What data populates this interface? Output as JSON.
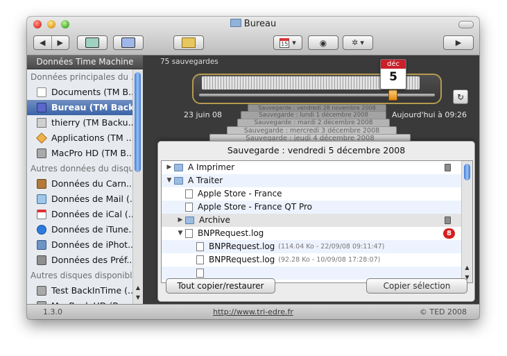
{
  "window": {
    "title": "Bureau"
  },
  "toolbar": {
    "back_icon": "arrow-left-icon",
    "forward_icon": "arrow-right-icon",
    "calendar_day": "15",
    "chevron": "▾",
    "play_icon": "▶"
  },
  "sidebar": {
    "header": "Données Time Machine",
    "groups": [
      {
        "label": "Données principales du ...",
        "items": [
          {
            "label": "Documents (TM B...",
            "icon": "document-icon"
          },
          {
            "label": "Bureau (TM Backu...",
            "icon": "desktop-icon",
            "selected": true
          },
          {
            "label": "thierry (TM Backu...",
            "icon": "home-icon"
          },
          {
            "label": "Applications (TM ...",
            "icon": "applications-icon"
          },
          {
            "label": "MacPro HD (TM B...",
            "icon": "hard-disk-icon"
          }
        ]
      },
      {
        "label": "Autres données du disque...",
        "items": [
          {
            "label": "Données du Carn...",
            "icon": "address-book-icon"
          },
          {
            "label": "Données de Mail (...",
            "icon": "mail-icon"
          },
          {
            "label": "Données de iCal (...",
            "icon": "ical-icon"
          },
          {
            "label": "Données de iTune...",
            "icon": "itunes-icon"
          },
          {
            "label": "Données de iPhot...",
            "icon": "iphoto-icon"
          },
          {
            "label": "Données des Préf...",
            "icon": "preferences-icon"
          }
        ]
      },
      {
        "label": "Autres disques disponibles",
        "items": [
          {
            "label": "Test BackInTime (...",
            "icon": "hard-disk-icon"
          },
          {
            "label": "MacBook HD (Ba...",
            "icon": "hard-disk-icon"
          }
        ]
      }
    ]
  },
  "timeline": {
    "count": "75 sauvegardes",
    "start": "23 juin 08",
    "end": "Aujourd'hui à 09:26",
    "calendar_month": "déc",
    "calendar_day": "5",
    "refresh_icon": "↻",
    "stack": [
      "Sauvegarde : vendredi 28 novembre 2008",
      "Sauvegarde : lundi 1 décembre 2008",
      "Sauvegarde : mardi 2 décembre 2008",
      "Sauvegarde : mercredi 3 décembre 2008",
      "Sauvegarde : jeudi 4 décembre 2008"
    ]
  },
  "backup": {
    "title": "Sauvegarde : vendredi 5 décembre 2008",
    "rows": [
      {
        "name": "A Imprimer",
        "type": "folder",
        "expander": "▶",
        "level": 0,
        "trash": true
      },
      {
        "name": "A Traiter",
        "type": "folder",
        "expander": "▼",
        "level": 0
      },
      {
        "name": "Apple Store - France",
        "type": "file",
        "expander": "",
        "level": 1
      },
      {
        "name": "Apple Store - France QT Pro",
        "type": "file",
        "expander": "",
        "level": 1
      },
      {
        "name": "Archive",
        "type": "folder",
        "expander": "▶",
        "level": 1,
        "trash": true
      },
      {
        "name": "BNPRequest.log",
        "type": "file",
        "expander": "▼",
        "level": 1,
        "badge": "8"
      },
      {
        "name": "BNPRequest.log",
        "type": "file",
        "expander": "",
        "level": 2,
        "meta": "(114.04 Ko - 22/09/08 09:11:47)"
      },
      {
        "name": "BNPRequest.log",
        "type": "file",
        "expander": "",
        "level": 2,
        "meta": "(92.28 Ko - 10/09/08 17:28:07)"
      },
      {
        "name": "",
        "type": "file",
        "expander": "",
        "level": 2
      }
    ],
    "copy_all_label": "Tout copier/restaurer",
    "copy_selection_label": "Copier sélection"
  },
  "footer": {
    "version": "1.3.0",
    "url": "http://www.tri-edre.fr",
    "copyright": "© TED 2008"
  }
}
